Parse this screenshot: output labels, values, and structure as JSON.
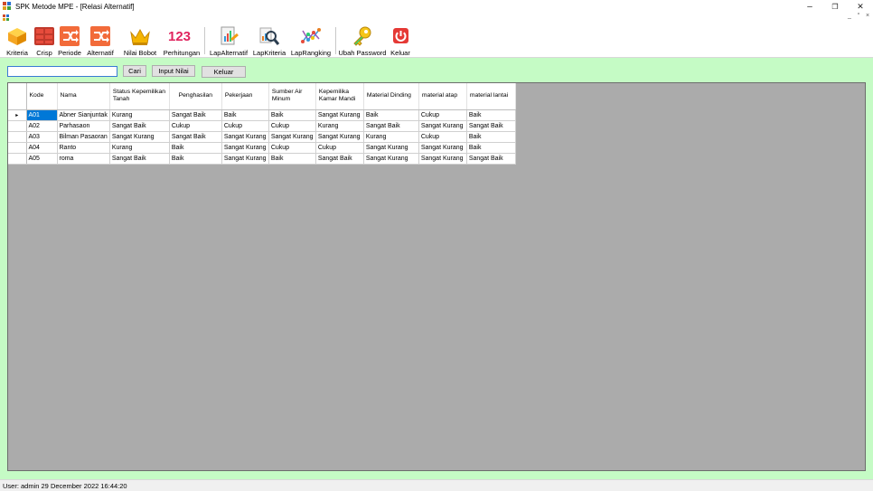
{
  "window": {
    "title": "SPK Metode MPE - [Relasi Alternatif]",
    "minimize_glyph": "–",
    "restore_glyph": "❐",
    "close_glyph": "✕"
  },
  "mdi": {
    "minimize_glyph": "_",
    "restore_glyph": "°",
    "close_glyph": "×"
  },
  "toolbar": {
    "items": [
      {
        "label": "Kriteria",
        "icon": "box-icon"
      },
      {
        "label": "Crisp",
        "icon": "brick-grid-icon"
      },
      {
        "label": "Periode",
        "icon": "shuffle-icon"
      },
      {
        "label": "Alternatif",
        "icon": "shuffle-icon"
      },
      {
        "label": "Nilai Bobot",
        "icon": "crown-icon"
      },
      {
        "label": "Perhitungan",
        "icon": "numbers-icon"
      },
      {
        "label": "LapAlternatif",
        "icon": "report-chart-icon"
      },
      {
        "label": "LapKriteria",
        "icon": "magnifier-report-icon"
      },
      {
        "label": "LapRangking",
        "icon": "network-chart-icon"
      },
      {
        "label": "Ubah Password",
        "icon": "key-icon"
      },
      {
        "label": "Keluar",
        "icon": "power-icon"
      }
    ],
    "numbers_icon_text": "123"
  },
  "form": {
    "search_value": "",
    "cari_label": "Cari",
    "input_nilai_label": "Input Nilai",
    "keluar_label": "Keluar"
  },
  "grid": {
    "row_indicator": "▸",
    "columns": [
      "Kode",
      "Nama",
      "Status Kepemilikan Tanah",
      "Penghasilan",
      "Pekerjaan",
      "Sumber Air Minum",
      "Kepemilika Kamar Mandi",
      "Material Dinding",
      "material atap",
      "material lantai"
    ],
    "rows": [
      [
        "A01",
        "Abner Sianjuntak",
        "Kurang",
        "Sangat Baik",
        "Baik",
        "Baik",
        "Sangat Kurang",
        "Baik",
        "Cukup",
        "Baik"
      ],
      [
        "A02",
        "Parhasaon",
        "Sangat Baik",
        "Cukup",
        "Cukup",
        "Cukup",
        "Kurang",
        "Sangat Baik",
        "Sangat Kurang",
        "Sangat Baik"
      ],
      [
        "A03",
        "Bilman Pasaoran",
        "Sangat Kurang",
        "Sangat Baik",
        "Sangat Kurang",
        "Sangat Kurang",
        "Sangat Kurang",
        "Kurang",
        "Cukup",
        "Baik"
      ],
      [
        "A04",
        "Ranto",
        "Kurang",
        "Baik",
        "Sangat Kurang",
        "Cukup",
        "Cukup",
        "Sangat Kurang",
        "Sangat Kurang",
        "Baik"
      ],
      [
        "A05",
        "roma",
        "Sangat Baik",
        "Baik",
        "Sangat Kurang",
        "Baik",
        "Sangat Baik",
        "Sangat Kurang",
        "Sangat Kurang",
        "Sangat Baik"
      ]
    ]
  },
  "status": {
    "text": "User: admin  29 December 2022 16:44:20"
  },
  "colors": {
    "form_background": "#c5fbc5",
    "grid_background": "#ababab",
    "selection": "#0078d7"
  }
}
